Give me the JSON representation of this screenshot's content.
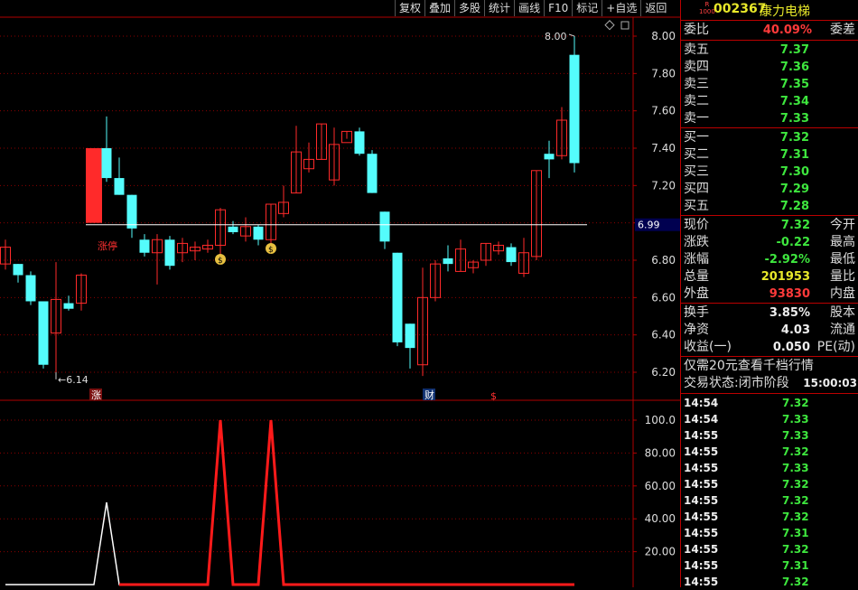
{
  "toolbar": [
    "复权",
    "叠加",
    "多股",
    "统计",
    "画线",
    "F10",
    "标记",
    "+自选",
    "返回"
  ],
  "stock": {
    "badge_top": "R",
    "badge_bottom": "1000",
    "code": "002367",
    "name": "康力电梯"
  },
  "weibi": {
    "label": "委比",
    "value": "40.09%",
    "label2": "委差"
  },
  "sell": [
    {
      "label": "卖五",
      "price": "7.37"
    },
    {
      "label": "卖四",
      "price": "7.36"
    },
    {
      "label": "卖三",
      "price": "7.35"
    },
    {
      "label": "卖二",
      "price": "7.34"
    },
    {
      "label": "卖一",
      "price": "7.33"
    }
  ],
  "buy": [
    {
      "label": "买一",
      "price": "7.32"
    },
    {
      "label": "买二",
      "price": "7.31"
    },
    {
      "label": "买三",
      "price": "7.30"
    },
    {
      "label": "买四",
      "price": "7.29"
    },
    {
      "label": "买五",
      "price": "7.28"
    }
  ],
  "stats": [
    {
      "label": "现价",
      "value": "7.32",
      "label2": "今开",
      "color": "#3ee63e"
    },
    {
      "label": "涨跌",
      "value": "-0.22",
      "label2": "最高",
      "color": "#3ee63e"
    },
    {
      "label": "涨幅",
      "value": "-2.92%",
      "label2": "最低",
      "color": "#3ee63e"
    },
    {
      "label": "总量",
      "value": "201953",
      "label2": "量比",
      "color": "#e8e82a"
    },
    {
      "label": "外盘",
      "value": "93830",
      "label2": "内盘",
      "color": "#ff3a3a"
    }
  ],
  "stats2": [
    {
      "label": "换手",
      "value": "3.85%",
      "label2": "股本"
    },
    {
      "label": "净资",
      "value": "4.03",
      "label2": "流通"
    },
    {
      "label": "收益(一)",
      "value": "0.050",
      "label2": "PE(动)"
    }
  ],
  "promo": "仅需20元查看千档行情",
  "trade_state": {
    "label": "交易状态:闭市阶段",
    "time": "15:00:03"
  },
  "ticks": [
    {
      "time": "14:54",
      "price": "7.32"
    },
    {
      "time": "14:54",
      "price": "7.33"
    },
    {
      "time": "14:55",
      "price": "7.33"
    },
    {
      "time": "14:55",
      "price": "7.32"
    },
    {
      "time": "14:55",
      "price": "7.33"
    },
    {
      "time": "14:55",
      "price": "7.32"
    },
    {
      "time": "14:55",
      "price": "7.32"
    },
    {
      "time": "14:55",
      "price": "7.32"
    },
    {
      "time": "14:55",
      "price": "7.31"
    },
    {
      "time": "14:55",
      "price": "7.32"
    },
    {
      "time": "14:55",
      "price": "7.31"
    },
    {
      "time": "14:55",
      "price": "7.32"
    }
  ],
  "colors": {
    "up": "#ff2a2a",
    "down": "#54fcfc",
    "grid": "#8b0000",
    "axis": "#b00000",
    "hline": "#ffffff",
    "green": "#3ee63e"
  },
  "chart_data": {
    "type": "candlestick",
    "price_axis": {
      "ticks": [
        "8.00",
        "7.80",
        "7.60",
        "7.40",
        "7.20",
        "7.00",
        "6.80",
        "6.60",
        "6.40",
        "6.20"
      ],
      "ylim": [
        6.1,
        8.1
      ]
    },
    "high_label": "8.00",
    "low_label": "6.14",
    "hline_value": "6.99",
    "markers": {
      "limit_up": "涨停",
      "zhang": "涨",
      "cai": "财",
      "money_tag": "$"
    },
    "candles": [
      {
        "o": 6.78,
        "c": 6.87,
        "h": 6.91,
        "l": 6.75
      },
      {
        "o": 6.78,
        "c": 6.72,
        "h": 6.78,
        "l": 6.68
      },
      {
        "o": 6.72,
        "c": 6.58,
        "h": 6.74,
        "l": 6.56
      },
      {
        "o": 6.58,
        "c": 6.24,
        "h": 6.58,
        "l": 6.22
      },
      {
        "o": 6.41,
        "c": 6.59,
        "h": 6.79,
        "l": 6.2
      },
      {
        "o": 6.57,
        "c": 6.54,
        "h": 6.61,
        "l": 6.53
      },
      {
        "o": 6.57,
        "c": 6.72,
        "h": 6.73,
        "l": 6.53
      },
      {
        "o": 7.0,
        "c": 7.4,
        "h": 7.4,
        "l": 7.0
      },
      {
        "o": 7.4,
        "c": 7.24,
        "h": 7.57,
        "l": 7.22
      },
      {
        "o": 7.24,
        "c": 7.15,
        "h": 7.35,
        "l": 7.15
      },
      {
        "o": 7.15,
        "c": 6.97,
        "h": 7.15,
        "l": 6.92
      },
      {
        "o": 6.91,
        "c": 6.84,
        "h": 6.94,
        "l": 6.82
      },
      {
        "o": 6.84,
        "c": 6.91,
        "h": 6.94,
        "l": 6.67
      },
      {
        "o": 6.91,
        "c": 6.77,
        "h": 6.93,
        "l": 6.75
      },
      {
        "o": 6.84,
        "c": 6.89,
        "h": 6.92,
        "l": 6.79
      },
      {
        "o": 6.85,
        "c": 6.87,
        "h": 6.9,
        "l": 6.8
      },
      {
        "o": 6.86,
        "c": 6.88,
        "h": 6.91,
        "l": 6.84
      },
      {
        "o": 6.88,
        "c": 7.07,
        "h": 7.08,
        "l": 6.82
      },
      {
        "o": 6.98,
        "c": 6.95,
        "h": 7.01,
        "l": 6.94
      },
      {
        "o": 6.93,
        "c": 6.98,
        "h": 7.03,
        "l": 6.9
      },
      {
        "o": 6.98,
        "c": 6.91,
        "h": 6.99,
        "l": 6.88
      },
      {
        "o": 6.91,
        "c": 7.1,
        "h": 7.1,
        "l": 6.89
      },
      {
        "o": 7.05,
        "c": 7.11,
        "h": 7.2,
        "l": 7.03
      },
      {
        "o": 7.16,
        "c": 7.38,
        "h": 7.52,
        "l": 7.16
      },
      {
        "o": 7.29,
        "c": 7.34,
        "h": 7.43,
        "l": 7.27
      },
      {
        "o": 7.34,
        "c": 7.53,
        "h": 7.53,
        "l": 7.34
      },
      {
        "o": 7.23,
        "c": 7.42,
        "h": 7.51,
        "l": 7.2
      },
      {
        "o": 7.43,
        "c": 7.49,
        "h": 7.49,
        "l": 7.45
      },
      {
        "o": 7.49,
        "c": 7.37,
        "h": 7.51,
        "l": 7.36
      },
      {
        "o": 7.37,
        "c": 7.16,
        "h": 7.39,
        "l": 7.16
      },
      {
        "o": 7.06,
        "c": 6.9,
        "h": 7.06,
        "l": 6.86
      },
      {
        "o": 6.84,
        "c": 6.36,
        "h": 6.84,
        "l": 6.34
      },
      {
        "o": 6.46,
        "c": 6.33,
        "h": 6.46,
        "l": 6.22
      },
      {
        "o": 6.24,
        "c": 6.6,
        "h": 6.76,
        "l": 6.18
      },
      {
        "o": 6.6,
        "c": 6.78,
        "h": 6.8,
        "l": 6.58
      },
      {
        "o": 6.81,
        "c": 6.78,
        "h": 6.88,
        "l": 6.74
      },
      {
        "o": 6.74,
        "c": 6.86,
        "h": 6.91,
        "l": 6.74
      },
      {
        "o": 6.76,
        "c": 6.79,
        "h": 6.8,
        "l": 6.73
      },
      {
        "o": 6.8,
        "c": 6.89,
        "h": 6.89,
        "l": 6.77
      },
      {
        "o": 6.85,
        "c": 6.88,
        "h": 6.9,
        "l": 6.83
      },
      {
        "o": 6.87,
        "c": 6.79,
        "h": 6.89,
        "l": 6.77
      },
      {
        "o": 6.73,
        "c": 6.84,
        "h": 6.92,
        "l": 6.71
      },
      {
        "o": 6.82,
        "c": 7.28,
        "h": 7.28,
        "l": 6.8
      },
      {
        "o": 7.37,
        "c": 7.34,
        "h": 7.44,
        "l": 7.24
      },
      {
        "o": 7.36,
        "c": 7.55,
        "h": 7.62,
        "l": 7.34
      },
      {
        "o": 7.9,
        "c": 7.32,
        "h": 8.0,
        "l": 7.27
      }
    ],
    "indicator": {
      "ticks": [
        "100.0",
        "80.00",
        "60.00",
        "40.00",
        "20.00"
      ],
      "ylim": [
        0,
        100
      ],
      "white_values": [
        0,
        0,
        0,
        0,
        0,
        0,
        0,
        0,
        50,
        0,
        0,
        0,
        0,
        0,
        0,
        0,
        0,
        0,
        0,
        0,
        0,
        0,
        0,
        0,
        0,
        0,
        0,
        0,
        0,
        0,
        0,
        0,
        0,
        0,
        0,
        0,
        0,
        0,
        0,
        0,
        0,
        0,
        0,
        0,
        0,
        0
      ],
      "red_values": [
        0,
        0,
        0,
        0,
        0,
        0,
        0,
        0,
        0,
        0,
        0,
        0,
        0,
        0,
        0,
        0,
        0,
        100,
        0,
        0,
        0,
        100,
        0,
        0,
        0,
        0,
        0,
        0,
        0,
        0,
        0,
        0,
        0,
        0,
        0,
        0,
        0,
        0,
        0,
        0,
        0,
        0,
        0,
        0,
        0,
        0
      ]
    }
  }
}
